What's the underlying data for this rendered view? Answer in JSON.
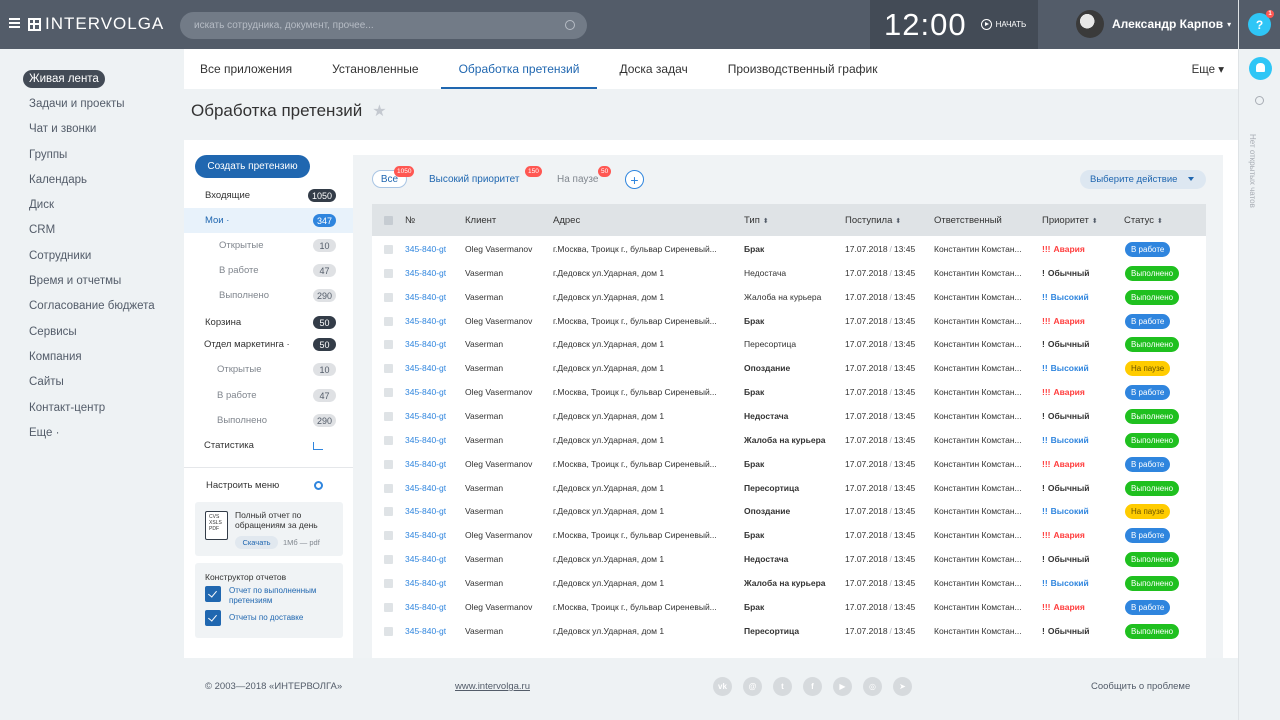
{
  "app": {
    "logo": "INTERVOLGA",
    "search_placeholder": "искать сотрудника, документ, прочее...",
    "clock": "12:00",
    "start_label": "НАЧАТЬ",
    "user_name": "Александр Карпов",
    "help_badge": "1"
  },
  "rail": {
    "vertical_text": "Нет открытых чатов"
  },
  "leftnav": [
    "Живая лента",
    "Задачи и проекты",
    "Чат и звонки",
    "Группы",
    "Календарь",
    "Диск",
    "CRM",
    "Сотрудники",
    "Время и отчетмы",
    "Согласование бюджета",
    "Сервисы",
    "Компания",
    "Сайты",
    "Контакт-центр",
    "Еще ·"
  ],
  "tabs": [
    "Все приложения",
    "Установленные",
    "Обработка претензий",
    "Доска задач",
    "Производственный график"
  ],
  "tabs_more": "Еще ▾",
  "page_title": "Обработка претензий",
  "subnav": {
    "create": "Создать претензию",
    "items": [
      {
        "label": "Входящие",
        "count": "1050"
      },
      {
        "label": "Мои ·",
        "count": "347"
      },
      {
        "label": "Открытые",
        "count": "10"
      },
      {
        "label": "В работе",
        "count": "47"
      },
      {
        "label": "Выполнено",
        "count": "290"
      },
      {
        "label": "Корзина",
        "count": "50"
      },
      {
        "label": "Отдел маркетинга ·",
        "count": "50"
      },
      {
        "label": "Открытые",
        "count": "10"
      },
      {
        "label": "В работе",
        "count": "47"
      },
      {
        "label": "Выполнено",
        "count": "290"
      },
      {
        "label": "Статистика",
        "count": ""
      }
    ],
    "settings": "Настроить меню",
    "report_card": {
      "icon_text": "CVS\nXSLS\nPDF",
      "title": "Полный отчет по обращениям за день",
      "download": "Скачать",
      "size": "1Мб — pdf"
    },
    "constructor": {
      "title": "Конструктор отчетов",
      "reports": [
        "Отчет по выполненным претензиям",
        "Отчеты по доставке"
      ]
    }
  },
  "filters": {
    "all": "Все",
    "all_count": "1050",
    "high": "Высокий приоритет",
    "high_count": "150",
    "pause": "На паузе",
    "pause_count": "50",
    "action": "Выберите действие"
  },
  "table": {
    "columns": [
      "№",
      "Клиент",
      "Адрес",
      "Тип",
      "Поступила",
      "Ответственный",
      "Приоритет",
      "Статус"
    ],
    "rows": [
      {
        "id": "345-840-gt",
        "client": "Oleg Vasermanov",
        "addr": "г.Москва, Троицк г., бульвар Сиреневый...",
        "type": "Брак",
        "date": "17.07.2018",
        "time": "13:45",
        "resp": "Константин Комстан...",
        "prio": "Авария",
        "prio_mark": "!!!",
        "status": "В работе"
      },
      {
        "id": "345-840-gt",
        "client": "Vaserman",
        "addr": "г.Дедовск ул.Ударная, дом 1",
        "type": "Недостача",
        "date": "17.07.2018",
        "time": "13:45",
        "resp": "Константин Комстан...",
        "prio": "Обычный",
        "prio_mark": "!",
        "status": "Выполнено"
      },
      {
        "id": "345-840-gt",
        "client": "Vaserman",
        "addr": "г.Дедовск ул.Ударная, дом 1",
        "type": "Жалоба на курьера",
        "date": "17.07.2018",
        "time": "13:45",
        "resp": "Константин Комстан...",
        "prio": "Высокий",
        "prio_mark": "!!",
        "status": "Выполнено"
      },
      {
        "id": "345-840-gt",
        "client": "Oleg Vasermanov",
        "addr": "г.Москва, Троицк г., бульвар Сиреневый...",
        "type": "Брак",
        "date": "17.07.2018",
        "time": "13:45",
        "resp": "Константин Комстан...",
        "prio": "Авария",
        "prio_mark": "!!!",
        "status": "В работе"
      },
      {
        "id": "345-840-gt",
        "client": "Vaserman",
        "addr": "г.Дедовск ул.Ударная, дом 1",
        "type": "Пересортица",
        "date": "17.07.2018",
        "time": "13:45",
        "resp": "Константин Комстан...",
        "prio": "Обычный",
        "prio_mark": "!",
        "status": "Выполнено"
      },
      {
        "id": "345-840-gt",
        "client": "Vaserman",
        "addr": "г.Дедовск ул.Ударная, дом 1",
        "type": "Опоздание",
        "date": "17.07.2018",
        "time": "13:45",
        "resp": "Константин Комстан...",
        "prio": "Высокий",
        "prio_mark": "!!",
        "status": "На паузе"
      },
      {
        "id": "345-840-gt",
        "client": "Oleg Vasermanov",
        "addr": "г.Москва, Троицк г., бульвар Сиреневый...",
        "type": "Брак",
        "date": "17.07.2018",
        "time": "13:45",
        "resp": "Константин Комстан...",
        "prio": "Авария",
        "prio_mark": "!!!",
        "status": "В работе"
      },
      {
        "id": "345-840-gt",
        "client": "Vaserman",
        "addr": "г.Дедовск ул.Ударная, дом 1",
        "type": "Недостача",
        "date": "17.07.2018",
        "time": "13:45",
        "resp": "Константин Комстан...",
        "prio": "Обычный",
        "prio_mark": "!",
        "status": "Выполнено"
      },
      {
        "id": "345-840-gt",
        "client": "Vaserman",
        "addr": "г.Дедовск ул.Ударная, дом 1",
        "type": "Жалоба на курьера",
        "date": "17.07.2018",
        "time": "13:45",
        "resp": "Константин Комстан...",
        "prio": "Высокий",
        "prio_mark": "!!",
        "status": "Выполнено"
      },
      {
        "id": "345-840-gt",
        "client": "Oleg Vasermanov",
        "addr": "г.Москва, Троицк г., бульвар Сиреневый...",
        "type": "Брак",
        "date": "17.07.2018",
        "time": "13:45",
        "resp": "Константин Комстан...",
        "prio": "Авария",
        "prio_mark": "!!!",
        "status": "В работе"
      },
      {
        "id": "345-840-gt",
        "client": "Vaserman",
        "addr": "г.Дедовск ул.Ударная, дом 1",
        "type": "Пересортица",
        "date": "17.07.2018",
        "time": "13:45",
        "resp": "Константин Комстан...",
        "prio": "Обычный",
        "prio_mark": "!",
        "status": "Выполнено"
      },
      {
        "id": "345-840-gt",
        "client": "Vaserman",
        "addr": "г.Дедовск ул.Ударная, дом 1",
        "type": "Опоздание",
        "date": "17.07.2018",
        "time": "13:45",
        "resp": "Константин Комстан...",
        "prio": "Высокий",
        "prio_mark": "!!",
        "status": "На паузе"
      },
      {
        "id": "345-840-gt",
        "client": "Oleg Vasermanov",
        "addr": "г.Москва, Троицк г., бульвар Сиреневый...",
        "type": "Брак",
        "date": "17.07.2018",
        "time": "13:45",
        "resp": "Константин Комстан...",
        "prio": "Авария",
        "prio_mark": "!!!",
        "status": "В работе"
      },
      {
        "id": "345-840-gt",
        "client": "Vaserman",
        "addr": "г.Дедовск ул.Ударная, дом 1",
        "type": "Недостача",
        "date": "17.07.2018",
        "time": "13:45",
        "resp": "Константин Комстан...",
        "prio": "Обычный",
        "prio_mark": "!",
        "status": "Выполнено"
      },
      {
        "id": "345-840-gt",
        "client": "Vaserman",
        "addr": "г.Дедовск ул.Ударная, дом 1",
        "type": "Жалоба на курьера",
        "date": "17.07.2018",
        "time": "13:45",
        "resp": "Константин Комстан...",
        "prio": "Высокий",
        "prio_mark": "!!",
        "status": "Выполнено"
      },
      {
        "id": "345-840-gt",
        "client": "Oleg Vasermanov",
        "addr": "г.Москва, Троицк г., бульвар Сиреневый...",
        "type": "Брак",
        "date": "17.07.2018",
        "time": "13:45",
        "resp": "Константин Комстан...",
        "prio": "Авария",
        "prio_mark": "!!!",
        "status": "В работе"
      },
      {
        "id": "345-840-gt",
        "client": "Vaserman",
        "addr": "г.Дедовск ул.Ударная, дом 1",
        "type": "Пересортица",
        "date": "17.07.2018",
        "time": "13:45",
        "resp": "Константин Комстан...",
        "prio": "Обычный",
        "prio_mark": "!",
        "status": "Выполнено"
      }
    ]
  },
  "colors": {
    "topbar": "#535c69",
    "accent": "#2067b0",
    "status_work": "#2f85de",
    "status_done": "#1fc01f",
    "status_pause": "#ffcc00",
    "prio_crash": "#ff3d3d"
  },
  "footer": {
    "copyright": "© 2003—2018  «ИНТЕРВОЛГА»",
    "site": "www.intervolga.ru",
    "social": [
      "vk-icon",
      "odnoklassniki-icon",
      "twitter-icon",
      "facebook-icon",
      "youtube-icon",
      "instagram-icon",
      "telegram-icon"
    ],
    "social_glyphs": [
      "vk",
      "@",
      "t",
      "f",
      "▶",
      "◎",
      "➤"
    ],
    "report": "Сообщить о проблеме"
  }
}
